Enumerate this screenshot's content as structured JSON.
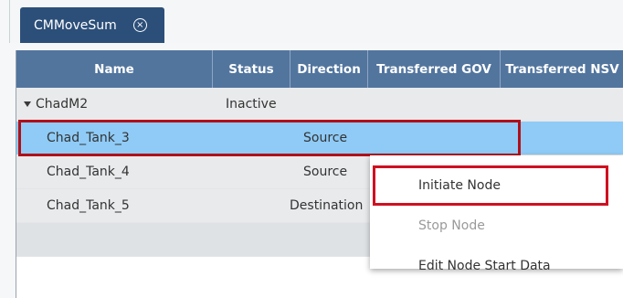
{
  "tab": {
    "label": "CMMoveSum",
    "close_icon": "close-circle-icon"
  },
  "columns": [
    "Name",
    "Status",
    "Direction",
    "Transferred GOV",
    "Transferred NSV"
  ],
  "rows": [
    {
      "name": "ChadM2",
      "status": "Inactive",
      "direction": ""
    },
    {
      "name": "Chad_Tank_3",
      "status": "",
      "direction": "Source"
    },
    {
      "name": "Chad_Tank_4",
      "status": "",
      "direction": "Source"
    },
    {
      "name": "Chad_Tank_5",
      "status": "",
      "direction": "Destination"
    }
  ],
  "context_menu": {
    "items": [
      {
        "label": "Initiate Node",
        "enabled": true
      },
      {
        "label": "Stop Node",
        "enabled": false
      },
      {
        "label": "Edit Node Start Data",
        "enabled": true
      }
    ]
  },
  "colors": {
    "header_bg": "#52759e",
    "tab_bg": "#2c4f79",
    "selected_row": "#8fcbf6",
    "highlight": "#c0101a"
  }
}
